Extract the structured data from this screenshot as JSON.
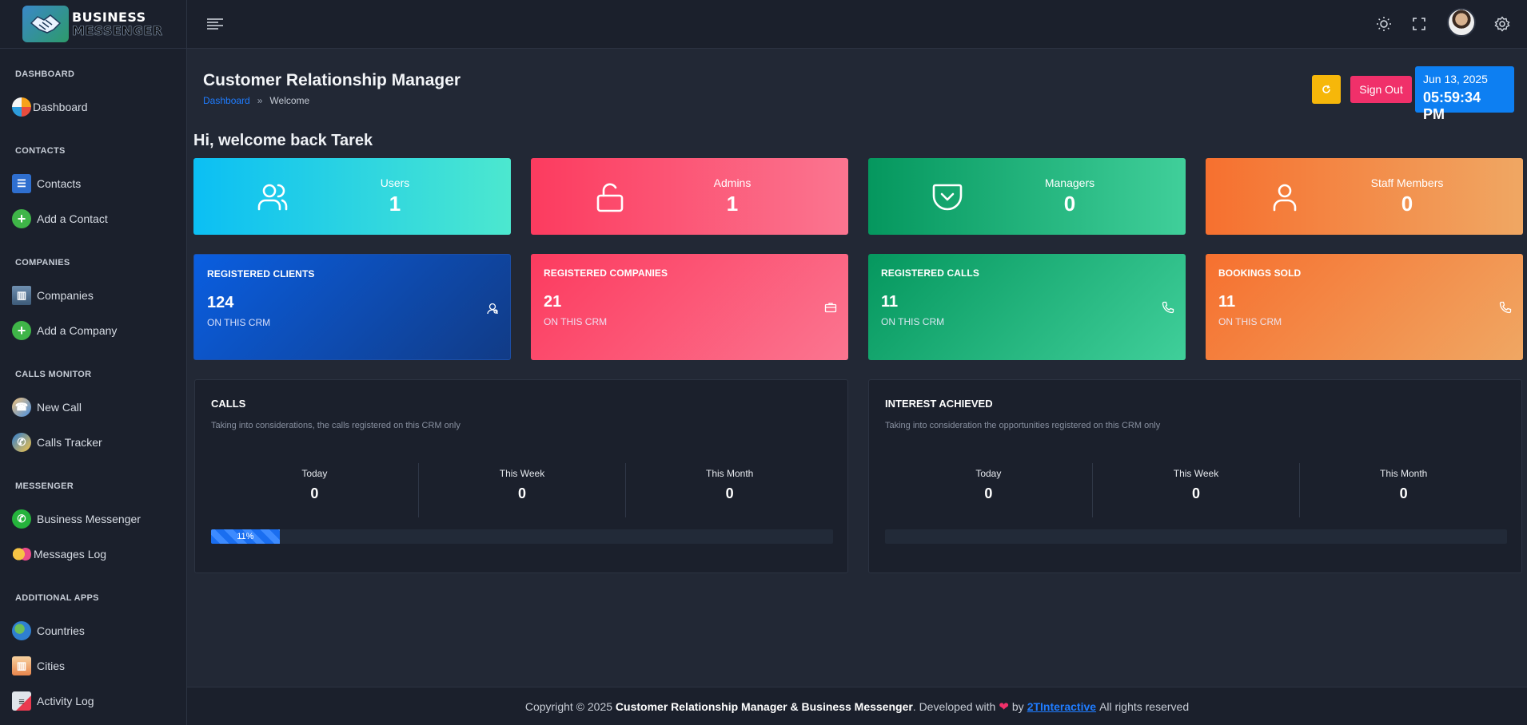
{
  "brand": {
    "line1": "BUSINESS",
    "line2": "MESSENGER"
  },
  "sidebar": {
    "sections": [
      {
        "title": "DASHBOARD",
        "items": [
          {
            "label": "Dashboard",
            "icon": "dashboard-icon"
          }
        ]
      },
      {
        "title": "CONTACTS",
        "items": [
          {
            "label": "Contacts",
            "icon": "contacts-book-icon"
          },
          {
            "label": "Add a Contact",
            "icon": "plus-circle-icon"
          }
        ]
      },
      {
        "title": "COMPANIES",
        "items": [
          {
            "label": "Companies",
            "icon": "buildings-icon"
          },
          {
            "label": "Add a Company",
            "icon": "plus-circle-icon"
          }
        ]
      },
      {
        "title": "CALLS MONITOR",
        "items": [
          {
            "label": "New Call",
            "icon": "new-call-icon"
          },
          {
            "label": "Calls Tracker",
            "icon": "phone-tracker-icon"
          }
        ]
      },
      {
        "title": "MESSENGER",
        "items": [
          {
            "label": "Business Messenger",
            "icon": "whatsapp-icon"
          },
          {
            "label": "Messages Log",
            "icon": "chat-bubbles-icon"
          }
        ]
      },
      {
        "title": "ADDITIONAL APPS",
        "items": [
          {
            "label": "Countries",
            "icon": "globe-icon"
          },
          {
            "label": "Cities",
            "icon": "city-icon"
          },
          {
            "label": "Activity Log",
            "icon": "activity-log-icon"
          }
        ]
      }
    ]
  },
  "header": {
    "title": "Customer Relationship Manager",
    "breadcrumb": [
      "Dashboard",
      "Welcome"
    ],
    "breadcrumb_sep": "»",
    "signout": "Sign Out",
    "date": "Jun 13, 2025",
    "time": "05:59:34 PM"
  },
  "welcome": "Hi, welcome back Tarek",
  "stat_cards": [
    {
      "label": "Users",
      "value": "1",
      "icon": "users-icon",
      "colors": [
        "#0bbff4",
        "#4ce8cf"
      ]
    },
    {
      "label": "Admins",
      "value": "1",
      "icon": "unlock-icon",
      "colors": [
        "#fc3b5f",
        "#fb7590"
      ]
    },
    {
      "label": "Managers",
      "value": "0",
      "icon": "pocket-icon",
      "colors": [
        "#05975e",
        "#40cf9a"
      ]
    },
    {
      "label": "Staff Members",
      "value": "0",
      "icon": "user-icon",
      "colors": [
        "#f6702f",
        "#f0a763"
      ]
    }
  ],
  "registered_cards": [
    {
      "title": "REGISTERED CLIENTS",
      "value": "124",
      "sub": "ON THIS CRM",
      "icon": "user-search-icon",
      "colors": [
        "#0a5ee0",
        "#113b86"
      ]
    },
    {
      "title": "REGISTERED COMPANIES",
      "value": "21",
      "sub": "ON THIS CRM",
      "icon": "briefcase-icon",
      "colors": [
        "#fc3b5f",
        "#fb7590"
      ]
    },
    {
      "title": "REGISTERED CALLS",
      "value": "11",
      "sub": "ON THIS CRM",
      "icon": "phone-icon",
      "colors": [
        "#05975e",
        "#40cf9a"
      ]
    },
    {
      "title": "BOOKINGS SOLD",
      "value": "11",
      "sub": "ON THIS CRM",
      "icon": "phone-icon",
      "colors": [
        "#f6702f",
        "#f0a763"
      ]
    }
  ],
  "panels": [
    {
      "title": "CALLS",
      "desc": "Taking into considerations, the calls registered on this CRM only",
      "stats": [
        {
          "label": "Today",
          "value": "0"
        },
        {
          "label": "This Week",
          "value": "0"
        },
        {
          "label": "This Month",
          "value": "0"
        }
      ],
      "progress": 0.11,
      "progress_label": "11%"
    },
    {
      "title": "INTEREST ACHIEVED",
      "desc": "Taking into consideration the opportunities registered on this CRM only",
      "stats": [
        {
          "label": "Today",
          "value": "0"
        },
        {
          "label": "This Week",
          "value": "0"
        },
        {
          "label": "This Month",
          "value": "0"
        }
      ],
      "progress": 0,
      "progress_label": ""
    }
  ],
  "footer": {
    "pre": "Copyright © 2025",
    "app": "Customer Relationship Manager & Business Messenger",
    "mid": ". Developed with",
    "by": "by",
    "link": "2TInteractive",
    "post": "All rights reserved"
  }
}
